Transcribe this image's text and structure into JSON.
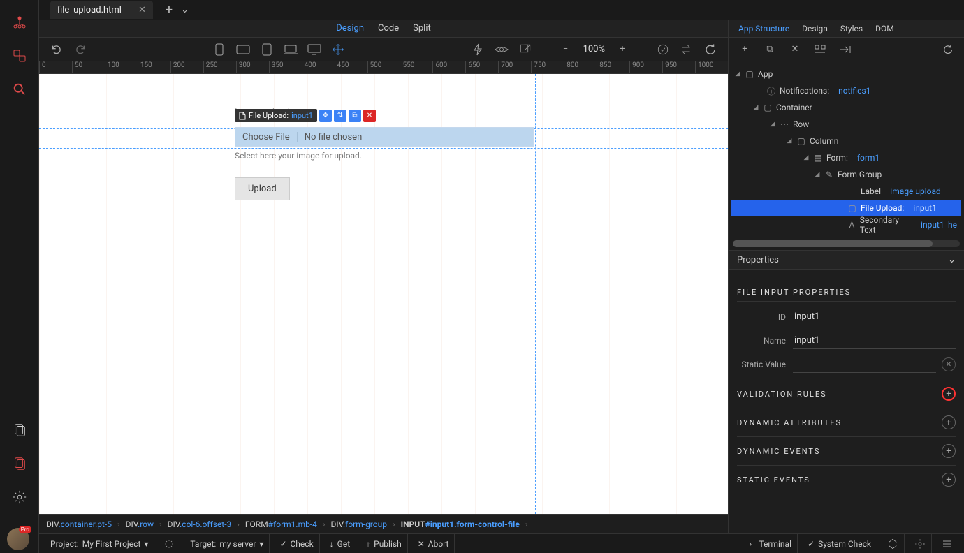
{
  "tab": {
    "filename": "file_upload.html"
  },
  "view_modes": {
    "design": "Design",
    "code": "Code",
    "split": "Split"
  },
  "zoom": "100%",
  "ruler_marks": [
    "0",
    "50",
    "100",
    "150",
    "200",
    "250",
    "300",
    "350",
    "400",
    "450",
    "500",
    "550",
    "600",
    "650",
    "700",
    "750",
    "800",
    "850",
    "900",
    "950",
    "1000"
  ],
  "element_tag": {
    "label": "File Upload:",
    "id": "input1"
  },
  "canvas": {
    "label_text": "Image upload",
    "choose_file": "Choose File",
    "no_file": "No file chosen",
    "help_text": "Select here your image for upload.",
    "upload_btn": "Upload"
  },
  "right_tabs": {
    "structure": "App Structure",
    "design": "Design",
    "styles": "Styles",
    "dom": "DOM"
  },
  "tree": {
    "app": "App",
    "notifications_label": "Notifications:",
    "notifications_id": "notifies1",
    "container": "Container",
    "row": "Row",
    "column": "Column",
    "form_label": "Form:",
    "form_id": "form1",
    "form_group": "Form Group",
    "label_label": "Label",
    "label_text": "Image upload",
    "file_upload_label": "File Upload:",
    "file_upload_id": "input1",
    "secondary_label": "Secondary Text",
    "secondary_id": "input1_he"
  },
  "properties": {
    "header": "Properties",
    "section_title": "FILE INPUT PROPERTIES",
    "id_label": "ID",
    "id_value": "input1",
    "name_label": "Name",
    "name_value": "input1",
    "static_label": "Static Value",
    "static_value": "",
    "validation": "VALIDATION RULES",
    "dyn_attrs": "DYNAMIC ATTRIBUTES",
    "dyn_events": "DYNAMIC EVENTS",
    "static_events": "STATIC EVENTS"
  },
  "breadcrumb": [
    {
      "tag": "DIV",
      "class": ".container.pt-5"
    },
    {
      "tag": "DIV",
      "class": ".row"
    },
    {
      "tag": "DIV",
      "class": ".col-6.offset-3"
    },
    {
      "tag": "FORM",
      "class": "#form1.mb-4"
    },
    {
      "tag": "DIV",
      "class": ".form-group"
    },
    {
      "tag": "INPUT",
      "class": "#input1.form-control-file"
    }
  ],
  "status": {
    "project_label": "Project:",
    "project_value": "My First Project",
    "target_label": "Target:",
    "target_value": "my server",
    "check": "Check",
    "get": "Get",
    "publish": "Publish",
    "abort": "Abort",
    "terminal": "Terminal",
    "system_check": "System Check"
  }
}
